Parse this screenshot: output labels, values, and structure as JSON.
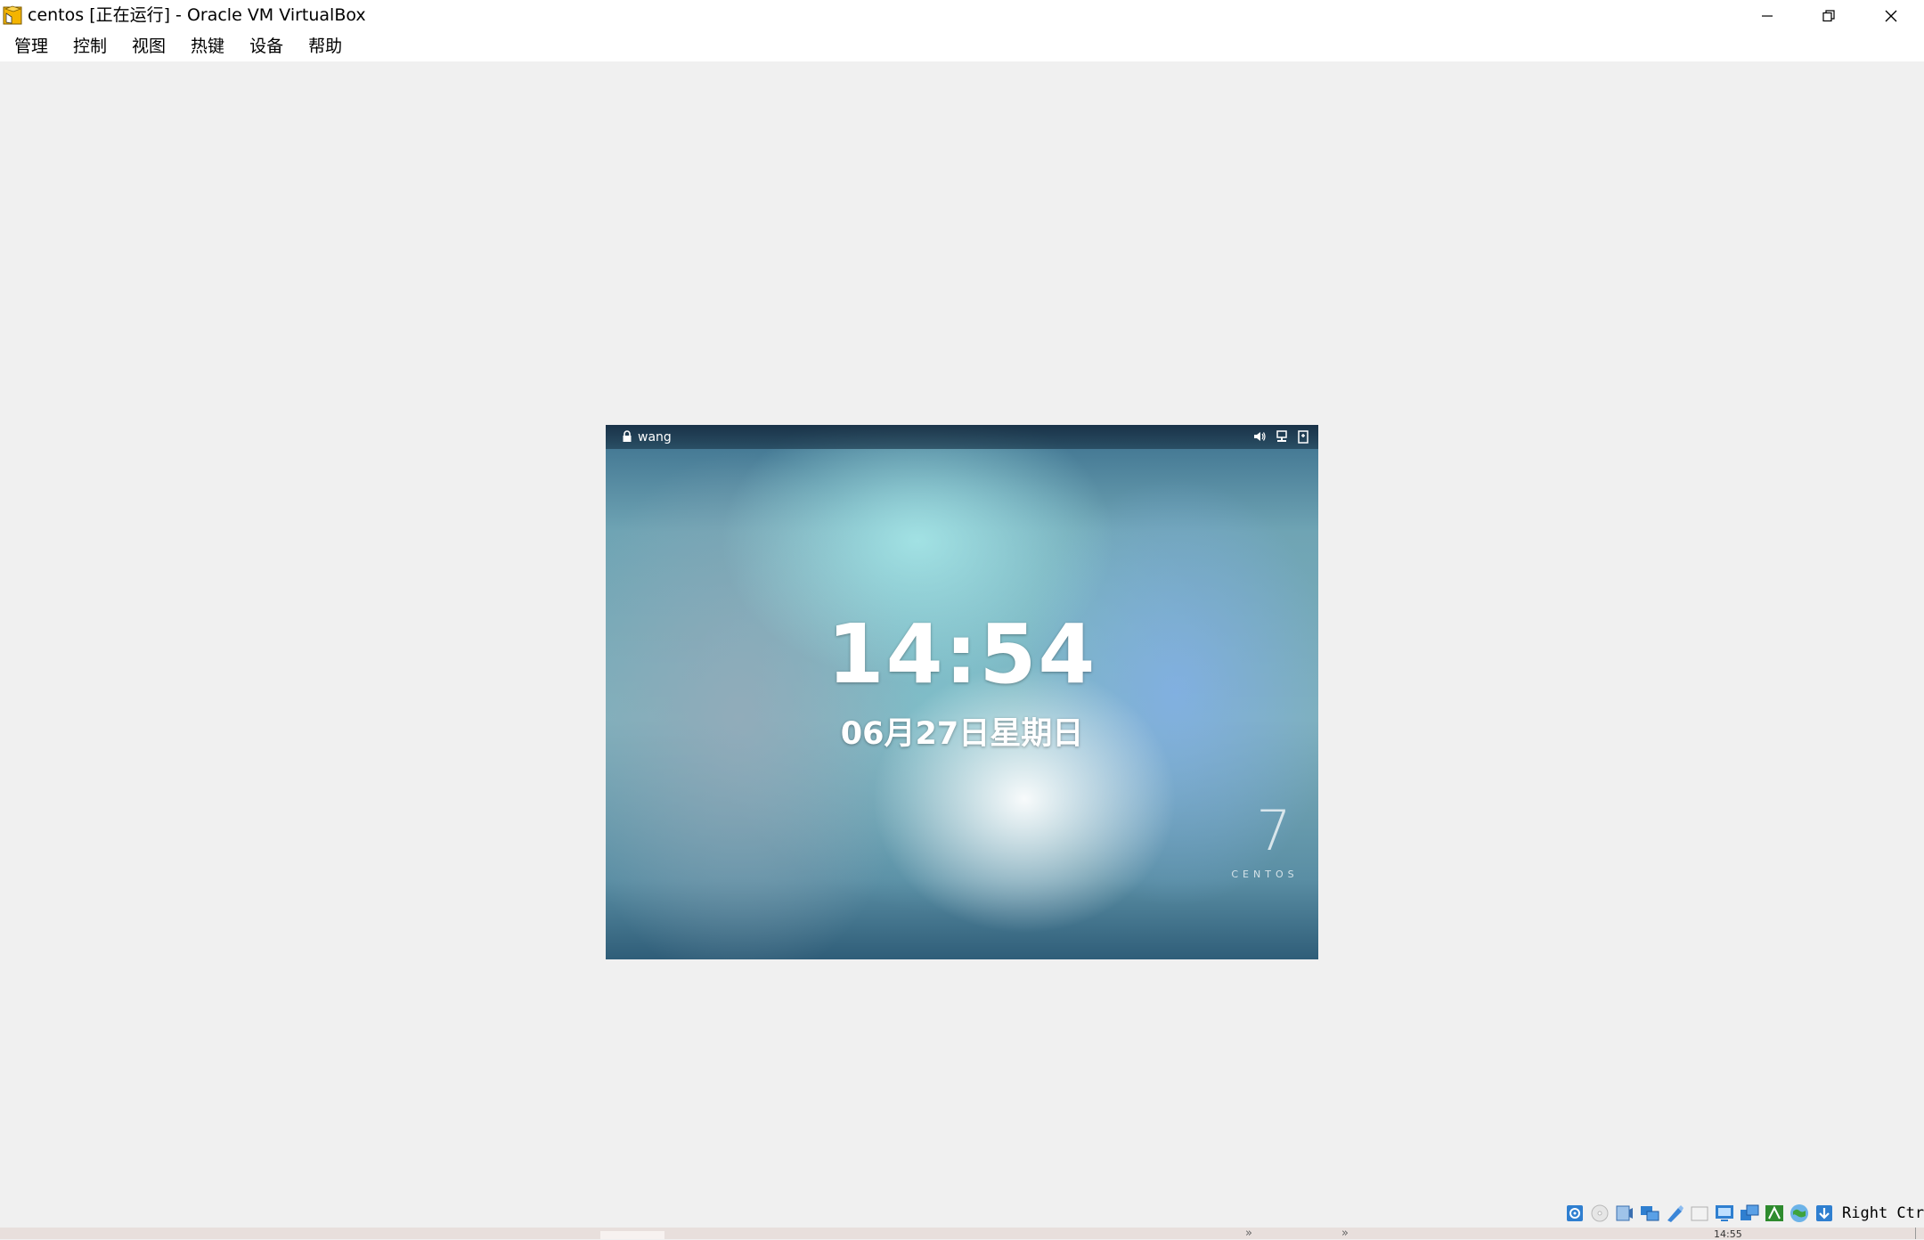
{
  "window": {
    "title": "centos [正在运行] - Oracle VM VirtualBox",
    "icons": {
      "app": "virtualbox-app-icon",
      "minimize": "minimize-icon",
      "restore": "restore-icon",
      "close": "close-icon"
    }
  },
  "menu": {
    "items": [
      "管理",
      "控制",
      "视图",
      "热键",
      "设备",
      "帮助"
    ]
  },
  "guest": {
    "top_bar": {
      "user": "wang",
      "icons": [
        "lock-icon",
        "volume-icon",
        "network-icon",
        "power-icon"
      ]
    },
    "lock_screen": {
      "time": "14:54",
      "date": "06月27日星期日"
    },
    "branding": {
      "version": "7",
      "name": "CENTOS"
    }
  },
  "status_bar": {
    "icons": [
      "hard-disk-icon",
      "optical-drive-icon",
      "audio-icon",
      "network-icon",
      "usb-icon",
      "shared-folders-icon",
      "display-icon",
      "video-capture-icon",
      "mouse-integration-icon",
      "cpu-activity-icon",
      "keyboard-capture-icon"
    ],
    "host_key": "Right Ctrl"
  },
  "host_taskbar": {
    "clock": "14:55"
  },
  "colors": {
    "window_bg": "#f0f0f0",
    "titlebar_bg": "#ffffff",
    "vm_accent": "#3a6e8c"
  }
}
